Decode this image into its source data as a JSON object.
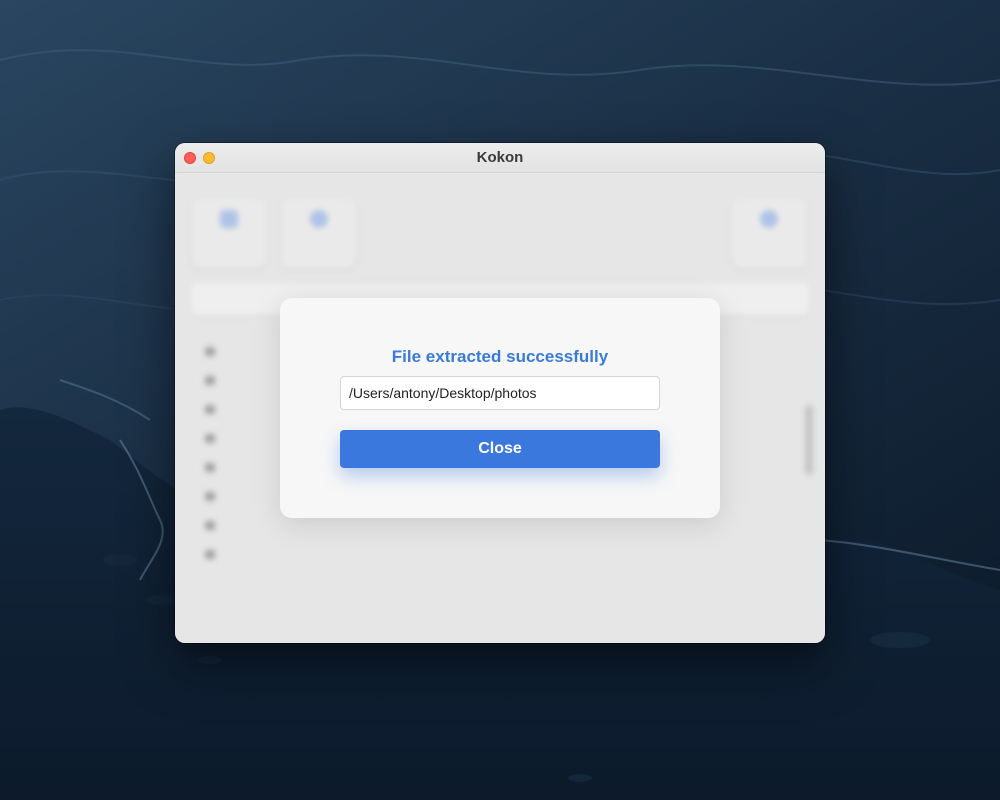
{
  "window": {
    "title": "Kokon"
  },
  "dialog": {
    "title": "File extracted successfully",
    "path_value": "/Users/antony/Desktop/photos",
    "close_label": "Close"
  },
  "colors": {
    "accent": "#3a78de",
    "title_blue": "#3a7ad8",
    "traffic_close": "#fe5f57",
    "traffic_minimize": "#febc2e"
  }
}
